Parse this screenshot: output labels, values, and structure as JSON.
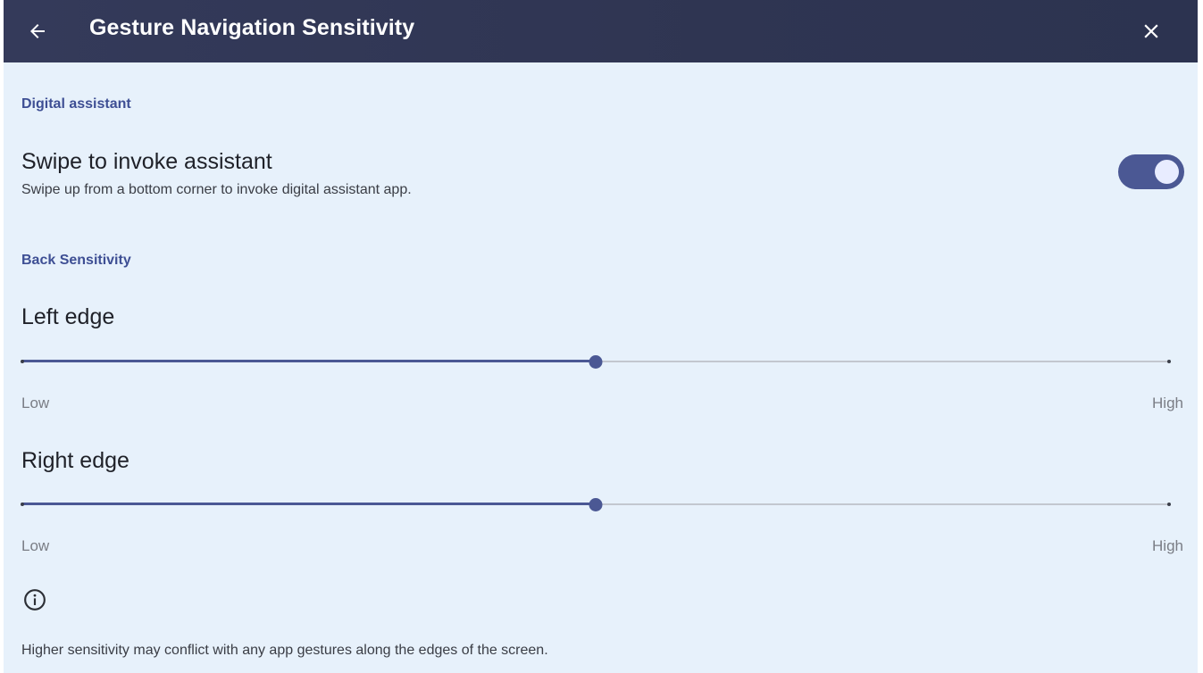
{
  "header": {
    "title": "Gesture Navigation Sensitivity",
    "back_icon": "arrow-left-icon",
    "close_icon": "close-icon",
    "background_color": "#2f3552"
  },
  "sections": {
    "digital_assistant": {
      "header": "Digital assistant",
      "toggle_row": {
        "title": "Swipe to invoke assistant",
        "subtitle": "Swipe up from a bottom corner to invoke digital assistant app.",
        "enabled": true
      }
    },
    "back_sensitivity": {
      "header": "Back Sensitivity",
      "left_edge": {
        "title": "Left edge",
        "value": 0.5,
        "min_label": "Low",
        "max_label": "High"
      },
      "right_edge": {
        "title": "Right edge",
        "value": 0.5,
        "min_label": "Low",
        "max_label": "High"
      }
    }
  },
  "footer": {
    "info_icon": "info-icon",
    "note": "Higher sensitivity may conflict with any app gestures along the edges of the screen."
  },
  "colors": {
    "accent": "#4b5894",
    "section_header": "#3e4f94",
    "background": "#e7f1fb"
  }
}
